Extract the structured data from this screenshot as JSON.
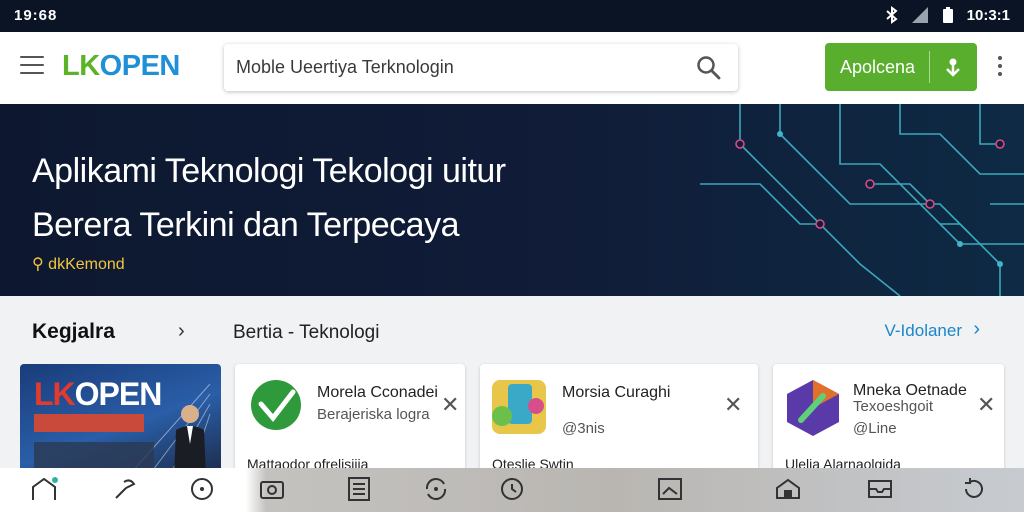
{
  "status_bar": {
    "time_left": "19:68",
    "time_right": "10:3:1"
  },
  "header": {
    "logo_part1": "LK",
    "logo_part2": "OPEN",
    "search_placeholder": "Moble Ueertiya Terknologin",
    "apply_button_label": "Apolcena",
    "icons": [
      "menu-icon",
      "search-icon",
      "download-icon",
      "more-vert-icon"
    ],
    "accent_color": "#5aae2e",
    "brand_blue": "#1f8fd6"
  },
  "hero": {
    "title_line1": "Aplikami Teknologi Tekologi uitur",
    "title_line2": "Berera Terkini dan Terpecaya",
    "tagline": "dkKemond"
  },
  "section": {
    "title": "Kegjalra",
    "subtitle": "Bertia - Teknologi",
    "see_all": "V-Idolaner"
  },
  "promo_card": {
    "title_part1": "LK",
    "title_part2": "OPEN"
  },
  "cards": [
    {
      "name": "Morela Cconadei",
      "sub": "Berajeriska logra",
      "foot": "Mattaodor ofrelisiiia"
    },
    {
      "name": "Morsia Curaghi",
      "sub": "@3nis",
      "foot": "Oteslie Swtin"
    },
    {
      "name": "Mneka Oetnade",
      "sub": "Texoeshgoit",
      "extra": "@Line",
      "foot": "Ulelia Alarnaolgida"
    }
  ],
  "bottom_nav": {
    "icons": [
      "home-icon",
      "tools-icon",
      "compass-icon",
      "camera-icon",
      "document-icon",
      "sync-icon",
      "timer-icon",
      "image-icon",
      "house-icon",
      "inbox-icon",
      "refresh-icon"
    ]
  }
}
